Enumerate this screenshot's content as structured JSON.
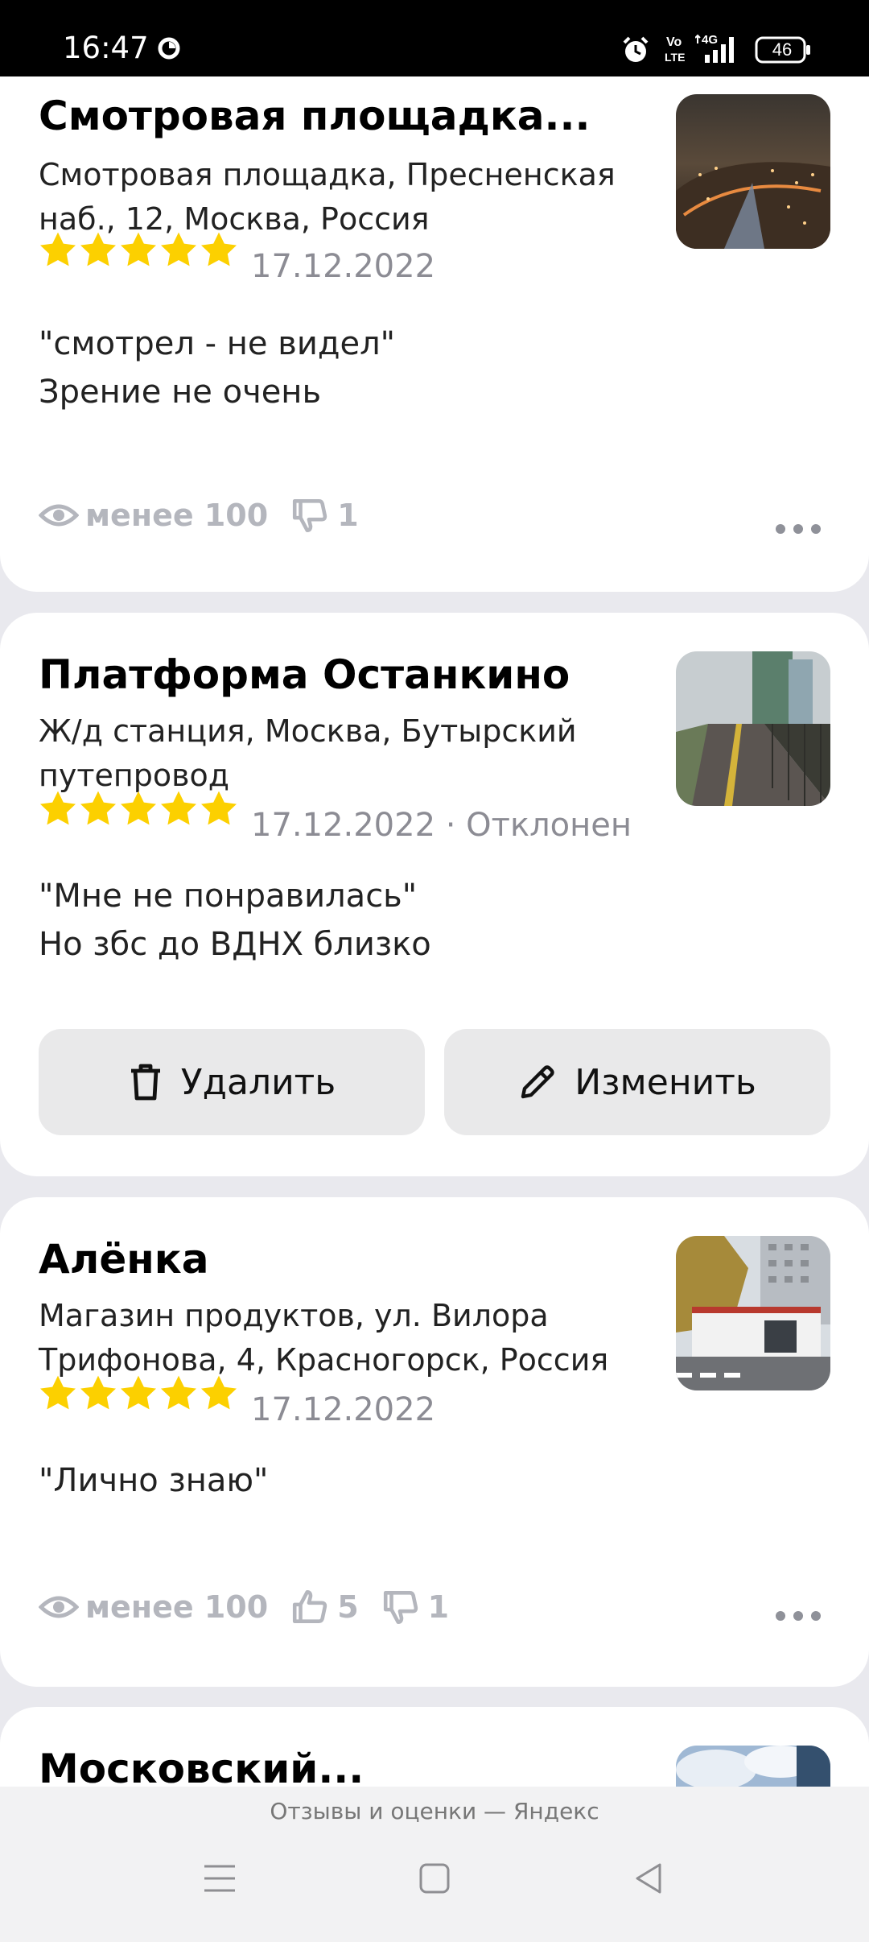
{
  "status_bar": {
    "time": "16:47",
    "network": "4G",
    "volte": "Vo LTE",
    "battery": "46"
  },
  "reviews": [
    {
      "title": "Смотровая площадка...",
      "address": "Смотровая площадка, Пресненская наб., 12, Москва, Россия",
      "rating": 5,
      "date": "17.12.2022",
      "status": "",
      "text_line1": "\"смотрел - не видел\"",
      "text_line2": "Зрение не очень",
      "views": "менее 100",
      "dislikes": "1"
    },
    {
      "title": "Платформа Останкино",
      "address": "Ж/д станция, Москва, Бутырский путепровод",
      "rating": 5,
      "date": "17.12.2022 · Отклонен",
      "text_line1": "\"Мне не понравилась\"",
      "text_line2": "Но збс до ВДНХ близко",
      "delete_label": "Удалить",
      "edit_label": "Изменить"
    },
    {
      "title": "Алёнка",
      "address": "Магазин продуктов, ул. Вилора Трифонова, 4, Красногорск, Россия",
      "rating": 5,
      "date": "17.12.2022",
      "text_line1": "\"Лично знаю\"",
      "views": "менее 100",
      "likes": "5",
      "dislikes": "1"
    },
    {
      "title": "Московский..."
    }
  ],
  "footer": {
    "caption": "Отзывы и оценки — Яндекс"
  },
  "colors": {
    "star": "#fcd000",
    "meta_gray": "#b4b6bd",
    "card_bg": "#ffffff",
    "page_bg": "#e9e9ee"
  },
  "icons": [
    "eye-icon",
    "thumb-up-icon",
    "thumb-down-icon",
    "trash-icon",
    "pencil-icon",
    "more-dots-icon",
    "menu-nav-icon",
    "home-nav-icon",
    "back-nav-icon",
    "alarm-icon",
    "signal-icon",
    "battery-icon"
  ]
}
